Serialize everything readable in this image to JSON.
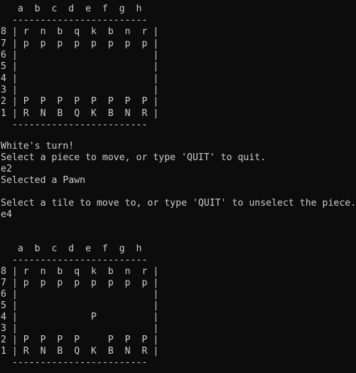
{
  "terminal": {
    "lines": [
      "   a  b  c  d  e  f  g  h",
      "  ------------------------",
      "8 | r  n  b  q  k  b  n  r |",
      "7 | p  p  p  p  p  p  p  p |",
      "6 |                        |",
      "5 |                        |",
      "4 |                        |",
      "3 |                        |",
      "2 | P  P  P  P  P  P  P  P |",
      "1 | R  N  B  Q  K  B  N  R |",
      "  ------------------------",
      "",
      "White's turn!",
      "Select a piece to move, or type 'QUIT' to quit.",
      "e2",
      "Selected a Pawn",
      "",
      "Select a tile to move to, or type 'QUIT' to unselect the piece.",
      "e4",
      "",
      "",
      "   a  b  c  d  e  f  g  h",
      "  ------------------------",
      "8 | r  n  b  q  k  b  n  r |",
      "7 | p  p  p  p  p  p  p  p |",
      "6 |                        |",
      "5 |                        |",
      "4 |             P          |",
      "3 |                        |",
      "2 | P  P  P  P     P  P  P |",
      "1 | R  N  B  Q  K  B  N  R |",
      "  ------------------------"
    ]
  }
}
